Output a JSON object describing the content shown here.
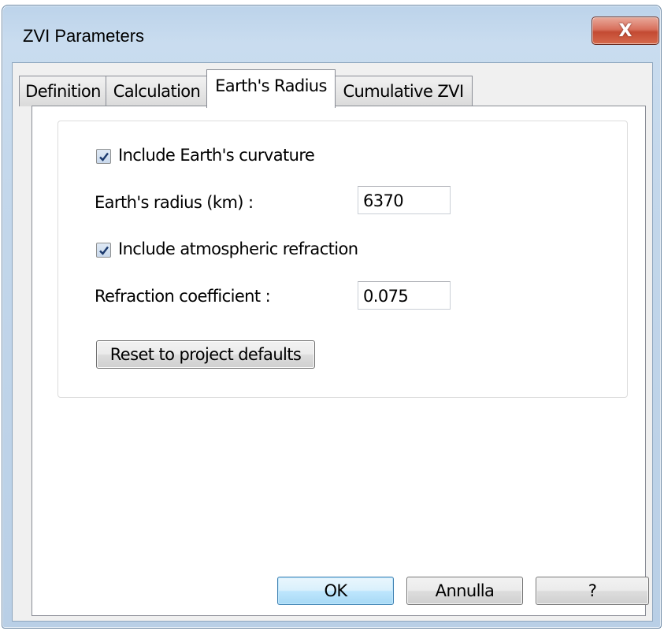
{
  "window": {
    "title": "ZVI Parameters",
    "close_glyph": "X",
    "close_icon": "close-icon"
  },
  "tabs": [
    {
      "label": "Definition"
    },
    {
      "label": "Calculation"
    },
    {
      "label": "Earth's Radius",
      "selected": true
    },
    {
      "label": "Cumulative ZVI"
    }
  ],
  "earth_radius_tab": {
    "include_curvature": {
      "label": "Include Earth's curvature",
      "checked": true
    },
    "radius": {
      "label": "Earth's radius (km) :",
      "value": "6370"
    },
    "include_refraction": {
      "label": "Include atmospheric refraction",
      "checked": true
    },
    "refraction": {
      "label": "Refraction coefficient :",
      "value": "0.075"
    },
    "reset_label": "Reset to project defaults"
  },
  "footer": {
    "ok_label": "OK",
    "cancel_label": "Annulla",
    "help_label": "?"
  },
  "colors": {
    "accent": "#3c7fb1",
    "close_button": "#c34a33",
    "checkmark": "#1c3a6e"
  }
}
